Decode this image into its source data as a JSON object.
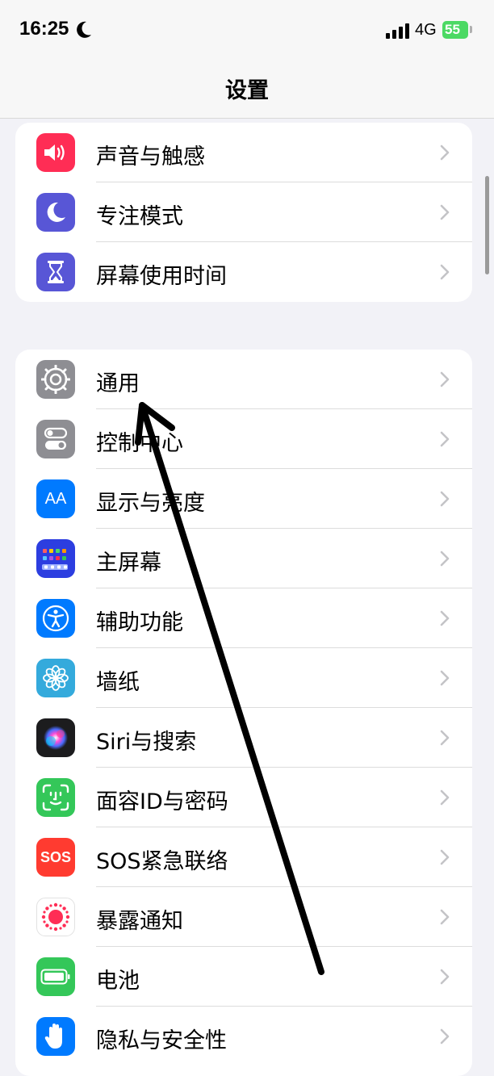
{
  "status_bar": {
    "time": "16:25",
    "network": "4G",
    "battery_level": "55",
    "moon_icon": "moon-icon",
    "signal_icon": "signal-bars-icon"
  },
  "nav": {
    "title": "设置"
  },
  "group_top": [
    {
      "label": "声音与触感",
      "icon": "speaker-icon",
      "color": "#ff2d55"
    },
    {
      "label": "专注模式",
      "icon": "moon-icon",
      "color": "#5856d6"
    },
    {
      "label": "屏幕使用时间",
      "icon": "hourglass-icon",
      "color": "#5856d6"
    }
  ],
  "group_main": [
    {
      "label": "通用",
      "icon": "gear-icon",
      "color": "#8e8e93"
    },
    {
      "label": "控制中心",
      "icon": "toggles-icon",
      "color": "#8e8e93"
    },
    {
      "label": "显示与亮度",
      "icon": "text-size-icon",
      "color": "#007aff",
      "glyph": "AA"
    },
    {
      "label": "主屏幕",
      "icon": "home-screen-icon",
      "color": "#2c3ee0"
    },
    {
      "label": "辅助功能",
      "icon": "accessibility-icon",
      "color": "#007aff"
    },
    {
      "label": "墙纸",
      "icon": "flower-icon",
      "color": "#34aadc"
    },
    {
      "label": "Siri与搜索",
      "icon": "siri-icon",
      "color": "#1c1c1e"
    },
    {
      "label": "面容ID与密码",
      "icon": "face-id-icon",
      "color": "#34c759"
    },
    {
      "label": "SOS紧急联络",
      "icon": "sos-icon",
      "color": "#ff3b30",
      "glyph": "SOS"
    },
    {
      "label": "暴露通知",
      "icon": "exposure-icon",
      "color": "#ffffff"
    },
    {
      "label": "电池",
      "icon": "battery-icon",
      "color": "#34c759"
    },
    {
      "label": "隐私与安全性",
      "icon": "hand-icon",
      "color": "#007aff"
    }
  ],
  "chevron_icon": "chevron-right-icon",
  "annotation_icon": "arrow-annotation-icon"
}
